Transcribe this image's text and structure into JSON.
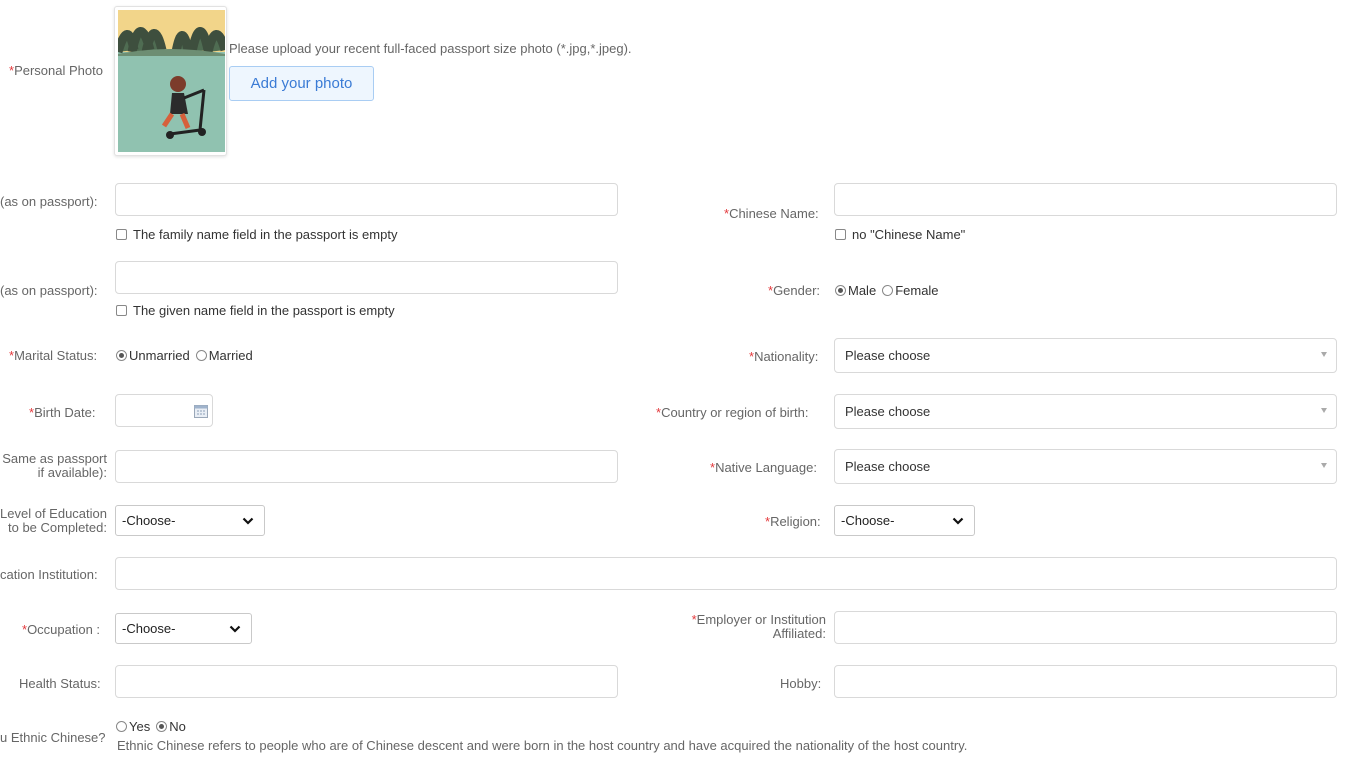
{
  "photo": {
    "label": "Personal Photo",
    "hint": "Please upload your recent full-faced passport size photo (*.jpg,*.jpeg).",
    "button": "Add your photo"
  },
  "family_name": {
    "label": "(as on passport):",
    "value": "",
    "empty_check": "The family name field in the passport is empty"
  },
  "given_name": {
    "label": "(as on passport):",
    "value": "",
    "empty_check": "The given name field in the passport is empty"
  },
  "chinese_name": {
    "label": "Chinese Name:",
    "value": "",
    "none_check": "no \"Chinese Name\""
  },
  "gender": {
    "label": "Gender:",
    "options": [
      "Male",
      "Female"
    ],
    "selected": "Male"
  },
  "marital": {
    "label": "Marital Status:",
    "options": [
      "Unmarried",
      "Married"
    ],
    "selected": "Unmarried"
  },
  "nationality": {
    "label": "Nationality:",
    "value": "Please choose"
  },
  "birth_date": {
    "label": "Birth Date:",
    "value": ""
  },
  "birth_country": {
    "label": "Country or region of birth:",
    "value": "Please choose"
  },
  "passport_field": {
    "label_line1": "Same as passport",
    "label_line2": "if available):",
    "value": ""
  },
  "native_language": {
    "label": "Native Language:",
    "value": "Please choose"
  },
  "education": {
    "label_line1": "Level of Education",
    "label_line2": "to be Completed:",
    "value": "-Choose-"
  },
  "religion": {
    "label": "Religion:",
    "value": "-Choose-"
  },
  "institution": {
    "label": "cation Institution:",
    "value": ""
  },
  "occupation": {
    "label": "Occupation :",
    "value": "-Choose-"
  },
  "employer": {
    "label_line1": "Employer or Institution",
    "label_line2": "Affiliated:",
    "value": ""
  },
  "health": {
    "label": "Health Status:",
    "value": ""
  },
  "hobby": {
    "label": "Hobby:",
    "value": ""
  },
  "ethnic": {
    "label": "u Ethnic Chinese?",
    "options": [
      "Yes",
      "No"
    ],
    "selected": "No",
    "note": "Ethnic Chinese refers to people who are of Chinese descent and were born in the host country and have acquired the nationality of the host country."
  },
  "colors": {
    "required": "#e4393c",
    "button_border": "#a9cdf3",
    "button_text": "#3a7bd5"
  }
}
